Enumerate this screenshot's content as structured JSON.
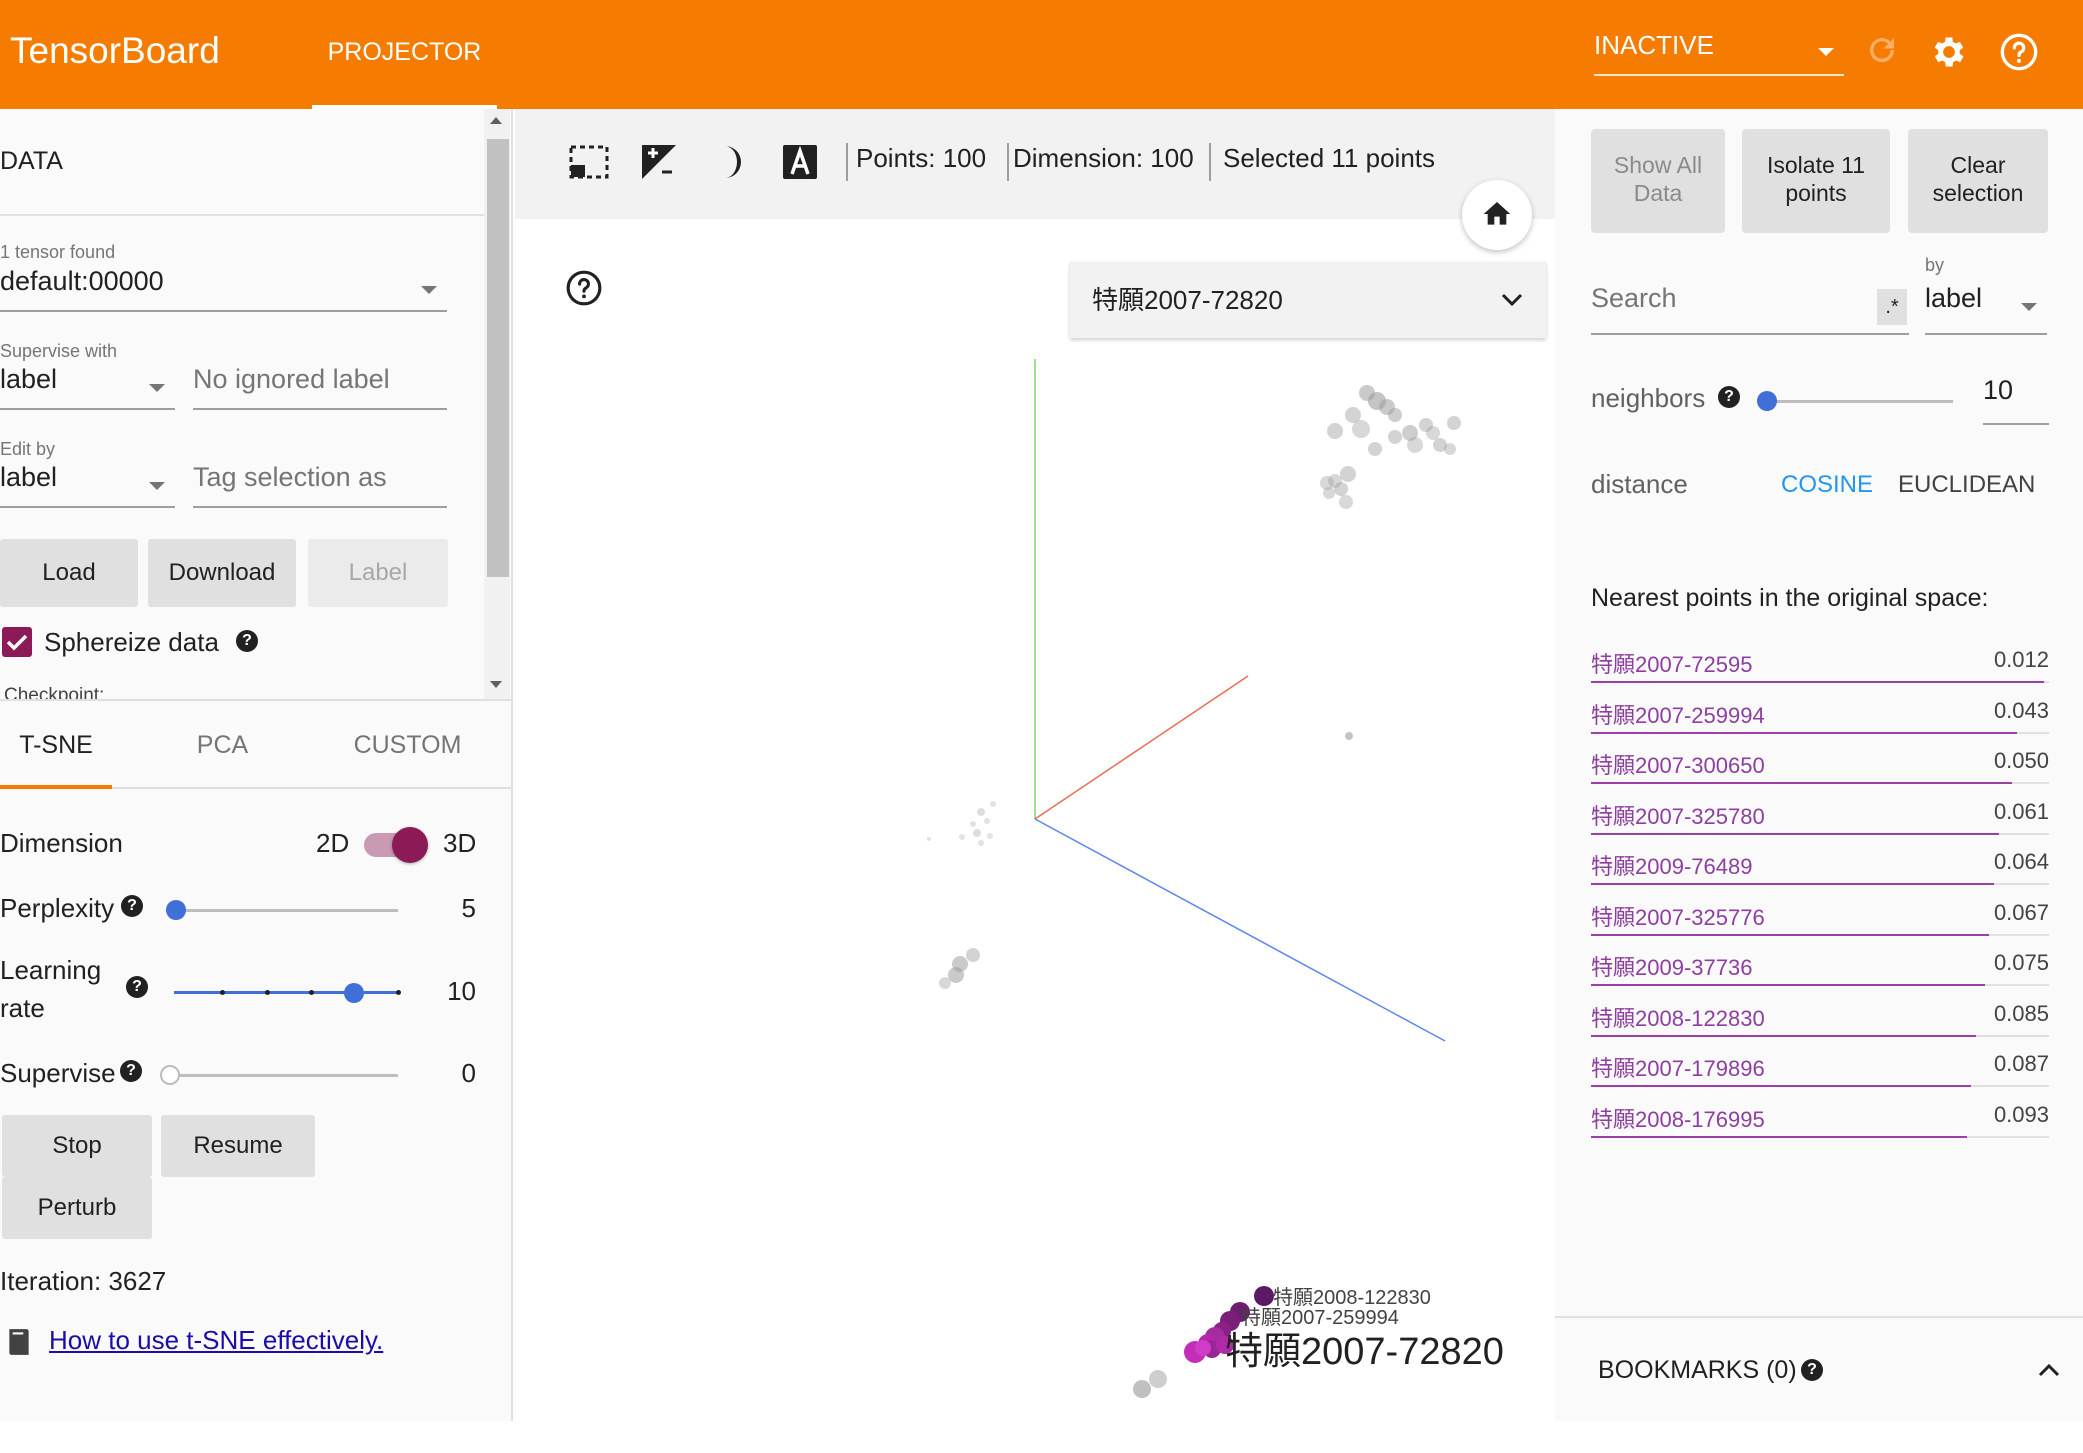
{
  "header": {
    "brand": "TensorBoard",
    "tab_projector": "PROJECTOR",
    "run_select": "INACTIVE",
    "accent": "#f57c00"
  },
  "data_panel": {
    "title": "DATA",
    "tensor_found": "1 tensor found",
    "tensor_value": "default:00000",
    "supervise_label": "Supervise with",
    "supervise_value": "label",
    "ignored_placeholder": "No ignored label",
    "edit_by_label": "Edit by",
    "edit_by_value": "label",
    "tag_placeholder": "Tag selection as",
    "load": "Load",
    "download": "Download",
    "label_btn": "Label",
    "sphereize": "Sphereize data",
    "checkpoint": "Checkpoint:"
  },
  "tsne": {
    "tabs": [
      "T-SNE",
      "PCA",
      "CUSTOM"
    ],
    "dimension_label": "Dimension",
    "dim_2d": "2D",
    "dim_3d": "3D",
    "perplexity_label": "Perplexity",
    "perplexity_value": "5",
    "learning_rate_line1": "Learning",
    "learning_rate_line2": "rate",
    "learning_rate_value": "10",
    "supervise_label": "Supervise",
    "supervise_value": "0",
    "stop": "Stop",
    "resume": "Resume",
    "perturb": "Perturb",
    "iteration": "Iteration: 3627",
    "howto_link": "How to use t-SNE effectively."
  },
  "toolbar": {
    "points": "Points: 100",
    "dimension": "Dimension: 100",
    "selected": "Selected 11 points"
  },
  "scene": {
    "label_select": "特願2007-72820",
    "labels": {
      "l1": "特願2008-122830",
      "l2": "特願2007-259994",
      "l3": "特願2007-72820"
    }
  },
  "inspector": {
    "show_all": [
      "Show All",
      "Data"
    ],
    "isolate": [
      "Isolate 11",
      "points"
    ],
    "clear": [
      "Clear",
      "selection"
    ],
    "search_placeholder": "Search",
    "regex": ".*",
    "by_label": "by",
    "by_value": "label",
    "neighbors_label": "neighbors",
    "neighbors_value": "10",
    "distance_label": "distance",
    "cosine": "COSINE",
    "euclidean": "EUCLIDEAN",
    "nearest_title": "Nearest points in the original space:",
    "nearest": [
      {
        "label": "特願2007-72595",
        "value": "0.012",
        "frac": 0.99
      },
      {
        "label": "特願2007-259994",
        "value": "0.043",
        "frac": 0.93
      },
      {
        "label": "特願2007-300650",
        "value": "0.050",
        "frac": 0.92
      },
      {
        "label": "特願2007-325780",
        "value": "0.061",
        "frac": 0.89
      },
      {
        "label": "特願2009-76489",
        "value": "0.064",
        "frac": 0.88
      },
      {
        "label": "特願2007-325776",
        "value": "0.067",
        "frac": 0.87
      },
      {
        "label": "特願2009-37736",
        "value": "0.075",
        "frac": 0.86
      },
      {
        "label": "特願2008-122830",
        "value": "0.085",
        "frac": 0.84
      },
      {
        "label": "特願2007-179896",
        "value": "0.087",
        "frac": 0.83
      },
      {
        "label": "特願2008-176995",
        "value": "0.093",
        "frac": 0.82
      }
    ],
    "bookmarks": "BOOKMARKS (0)"
  }
}
